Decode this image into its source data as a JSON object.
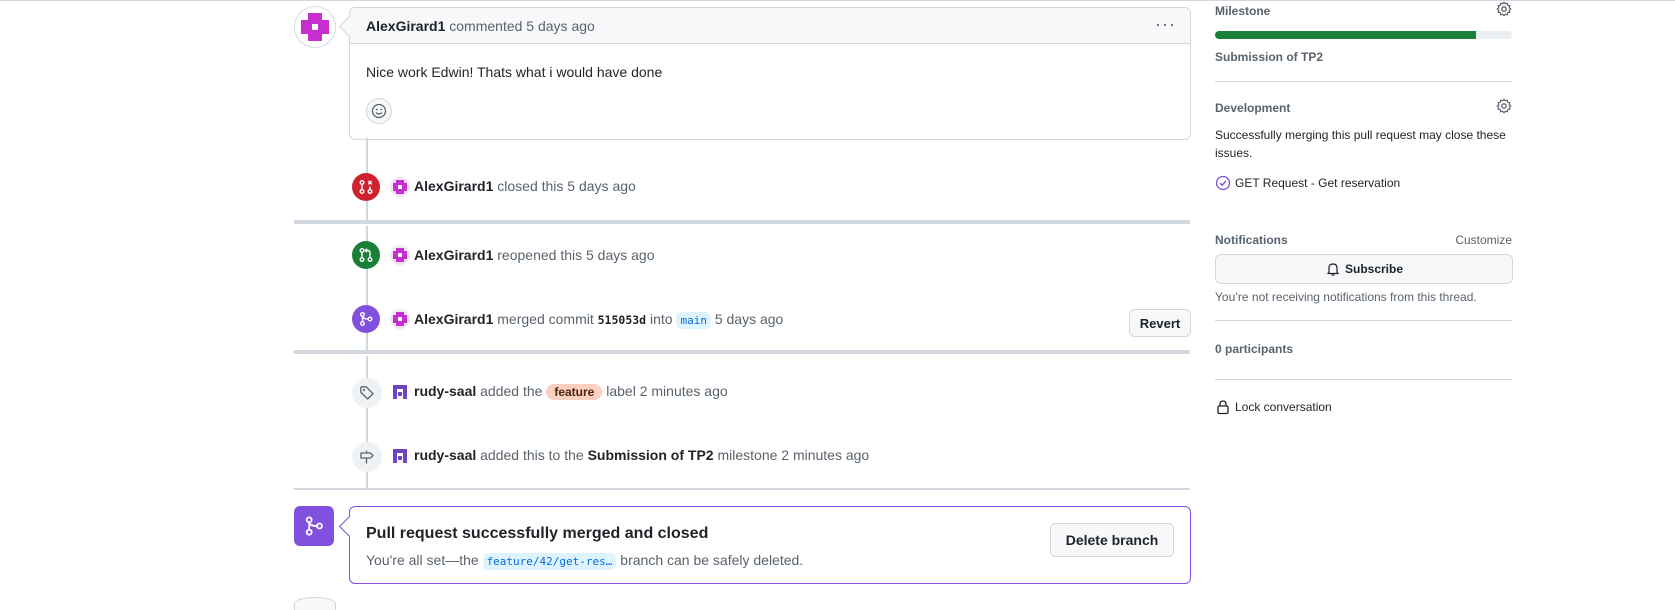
{
  "comment": {
    "author": "AlexGirard1",
    "meta": "commented 5 days ago",
    "body": "Nice work Edwin! Thats what i would have done",
    "menu_icon": "kebab-horizontal-icon",
    "reaction_icon": "smiley-icon"
  },
  "events": [
    {
      "icon": "git-pull-request-closed-icon",
      "color": "#cf222e",
      "actor": "AlexGirard1",
      "text": "closed this 5 days ago"
    },
    {
      "icon": "git-pull-request-icon",
      "color": "#1a7f37",
      "actor": "AlexGirard1",
      "text": "reopened this 5 days ago"
    },
    {
      "icon": "git-merge-icon",
      "color": "#8250df",
      "actor": "AlexGirard1",
      "text_pre": "merged commit",
      "commit": "515053d",
      "text_mid": "into",
      "branch": "main",
      "text_post": "5 days ago",
      "button": "Revert"
    },
    {
      "icon": "tag-icon",
      "actor": "rudy-saal",
      "text_pre": "added the",
      "label": "feature",
      "text_post": "label 2 minutes ago"
    },
    {
      "icon": "milestone-icon",
      "actor": "rudy-saal",
      "text_pre": "added this to the",
      "milestone": "Submission of TP2",
      "text_post": "milestone 2 minutes ago"
    }
  ],
  "merged_box": {
    "title": "Pull request successfully merged and closed",
    "sub_pre": "You're all set—the",
    "branch": "feature/42/get-res…",
    "sub_post": "branch can be safely deleted.",
    "button": "Delete branch"
  },
  "sidebar": {
    "milestone": {
      "heading": "Milestone",
      "name": "Submission of TP2",
      "progress": 0.88
    },
    "development": {
      "heading": "Development",
      "desc": "Successfully merging this pull request may close these issues.",
      "issue": "GET Request - Get reservation"
    },
    "notifications": {
      "heading": "Notifications",
      "customize": "Customize",
      "button": "Subscribe",
      "note": "You’re not receiving notifications from this thread."
    },
    "participants": "0 participants",
    "lock": "Lock conversation"
  },
  "colors": {
    "accent_purple": "#8250df",
    "closed_red": "#cf222e",
    "open_green": "#1a7f37",
    "avatar_magenta": "#c72ecf"
  }
}
